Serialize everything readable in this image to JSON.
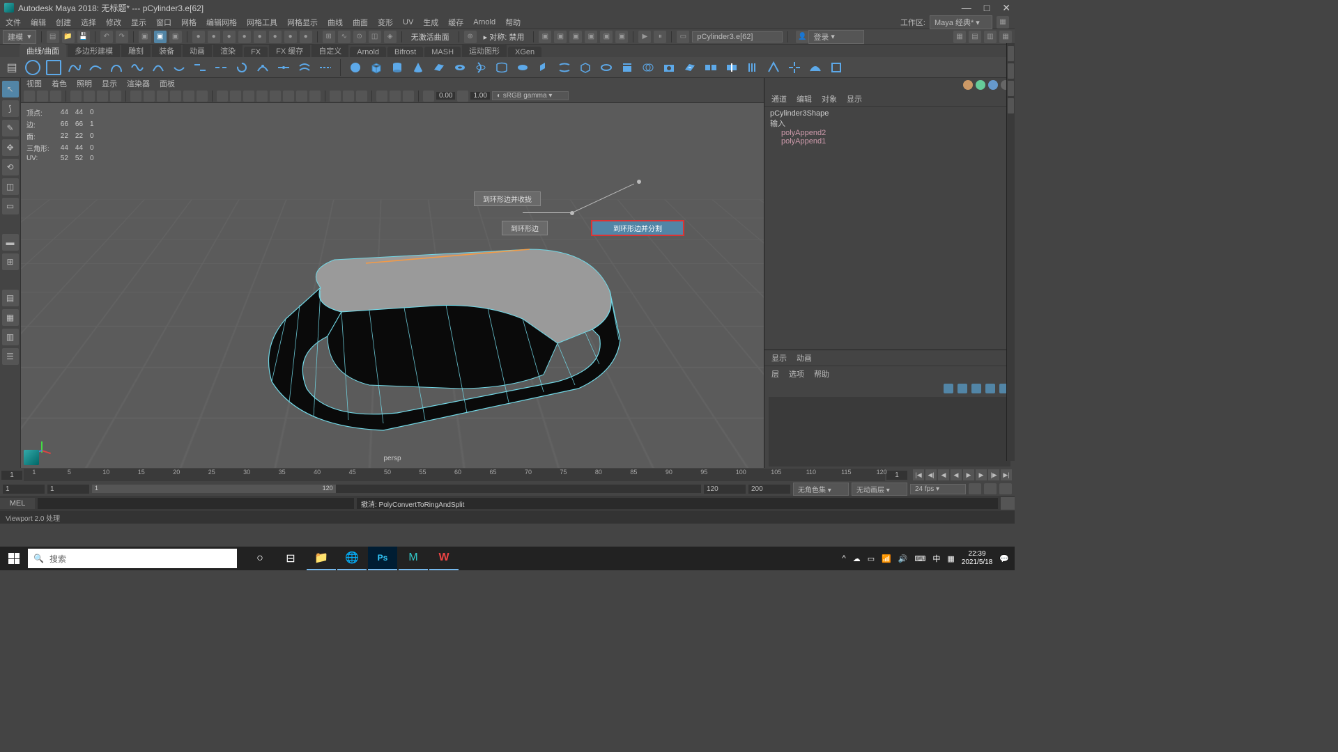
{
  "title": "Autodesk Maya 2018: 无标题*   ---   pCylinder3.e[62]",
  "menubar": [
    "文件",
    "编辑",
    "创建",
    "选择",
    "修改",
    "显示",
    "窗口",
    "网格",
    "编辑网格",
    "网格工具",
    "网格显示",
    "曲线",
    "曲面",
    "变形",
    "UV",
    "生成",
    "缓存",
    "Arnold",
    "帮助"
  ],
  "workspace": {
    "label": "工作区:",
    "value": "Maya 经典*"
  },
  "shelfbar1": {
    "modeDropdown": "建模",
    "statusLeft": "无激活曲面",
    "symLabel": "对称: 禁用",
    "objField": "pCylinder3.e[62]",
    "loginLabel": "登录"
  },
  "shelfTabs": [
    "曲线/曲面",
    "多边形建模",
    "雕刻",
    "装备",
    "动画",
    "渲染",
    "FX",
    "FX 缓存",
    "自定义",
    "Arnold",
    "Bifrost",
    "MASH",
    "运动图形",
    "XGen"
  ],
  "shelfActive": 0,
  "panelMenus": [
    "视图",
    "着色",
    "照明",
    "显示",
    "渲染器",
    "面板"
  ],
  "viewportStats": {
    "rows": [
      {
        "label": "顶点:",
        "a": "44",
        "b": "44",
        "c": "0"
      },
      {
        "label": "边:",
        "a": "66",
        "b": "66",
        "c": "1"
      },
      {
        "label": "面:",
        "a": "22",
        "b": "22",
        "c": "0"
      },
      {
        "label": "三角形:",
        "a": "44",
        "b": "44",
        "c": "0"
      },
      {
        "label": "UV:",
        "a": "52",
        "b": "52",
        "c": "0"
      }
    ]
  },
  "panelToolbar": {
    "num1": "0.00",
    "num2": "1.00",
    "colorspace": "sRGB gamma"
  },
  "perspLabel": "persp",
  "markingMenu": {
    "opt1": "到环形边并收拢",
    "opt2": "到环形边",
    "opt3": "到环形边并分割"
  },
  "channelBox": {
    "tabs": [
      "通道",
      "编辑",
      "对象",
      "显示"
    ],
    "shape": "pCylinder3Shape",
    "inputsLabel": "输入",
    "inputs": [
      "polyAppend2",
      "polyAppend1"
    ]
  },
  "layerPanel": {
    "tabs": [
      "显示",
      "动画"
    ],
    "row": [
      "层",
      "选项",
      "帮助"
    ]
  },
  "timeline": {
    "startField": "1",
    "ticks": [
      "1",
      "5",
      "10",
      "15",
      "20",
      "25",
      "30",
      "35",
      "40",
      "45",
      "50",
      "55",
      "60",
      "65",
      "70",
      "75",
      "80",
      "85",
      "90",
      "95",
      "100",
      "105",
      "110",
      "115",
      "120"
    ],
    "endField": "1"
  },
  "range": {
    "f1": "1",
    "f2": "1",
    "handleStart": "1",
    "handleEnd": "120",
    "f3": "120",
    "f4": "200",
    "d1": "无角色集",
    "d2": "无动画层",
    "d3": "24 fps"
  },
  "cmd": {
    "lang": "MEL",
    "message": "撤消: PolyConvertToRingAndSplit"
  },
  "statusLine": "Viewport 2.0 处理",
  "taskbar": {
    "searchPlaceholder": "搜索",
    "ime": "中",
    "time": "22:39",
    "date": "2021/5/18"
  }
}
